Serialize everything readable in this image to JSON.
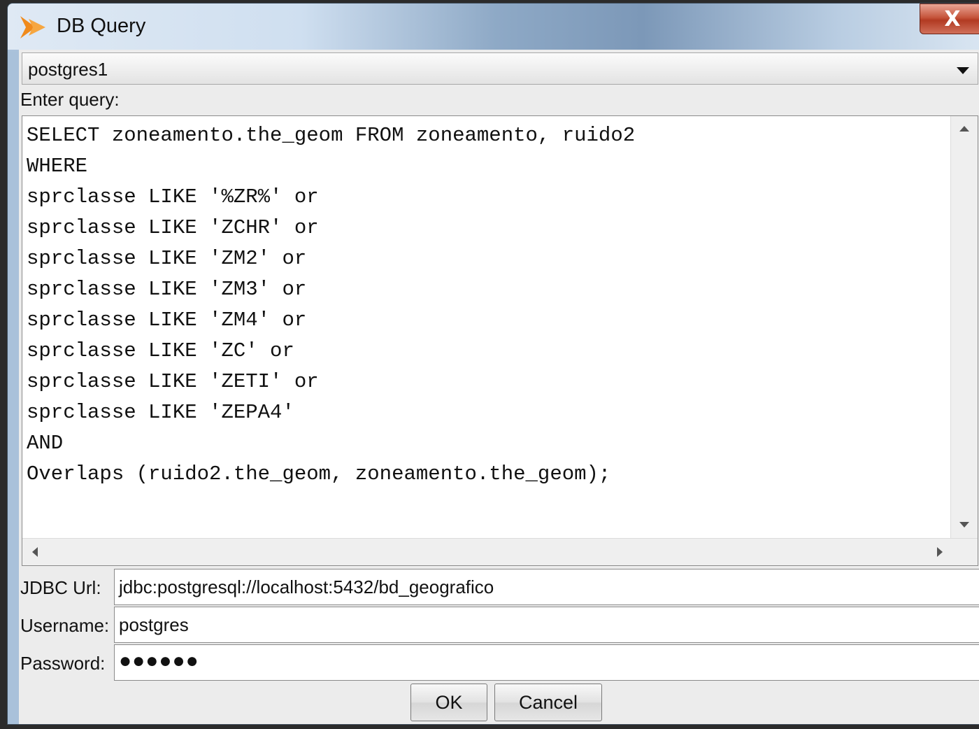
{
  "window": {
    "title": "DB Query",
    "close_label": "X"
  },
  "connection": {
    "selected": "postgres1"
  },
  "query": {
    "label": "Enter query:",
    "text": "SELECT zoneamento.the_geom FROM zoneamento, ruido2\nWHERE\nsprclasse LIKE '%ZR%' or\nsprclasse LIKE 'ZCHR' or\nsprclasse LIKE 'ZM2' or\nsprclasse LIKE 'ZM3' or\nsprclasse LIKE 'ZM4' or\nsprclasse LIKE 'ZC' or\nsprclasse LIKE 'ZETI' or\nsprclasse LIKE 'ZEPA4'\nAND\nOverlaps (ruido2.the_geom, zoneamento.the_geom);"
  },
  "form": {
    "jdbc_label": "JDBC Url:",
    "jdbc_value": "jdbc:postgresql://localhost:5432/bd_geografico",
    "username_label": "Username:",
    "username_value": "postgres",
    "password_label": "Password:",
    "password_value": "●●●●●●"
  },
  "buttons": {
    "ok": "OK",
    "cancel": "Cancel"
  },
  "icons": {
    "app": "app-logo-icon",
    "close": "close-icon",
    "dropdown": "chevron-down-icon",
    "scroll_up": "scroll-up-icon",
    "scroll_down": "scroll-down-icon",
    "scroll_left": "scroll-left-icon",
    "scroll_right": "scroll-right-icon"
  },
  "colors": {
    "close_button": "#c6553c",
    "title_bar": "#cfdff0"
  }
}
